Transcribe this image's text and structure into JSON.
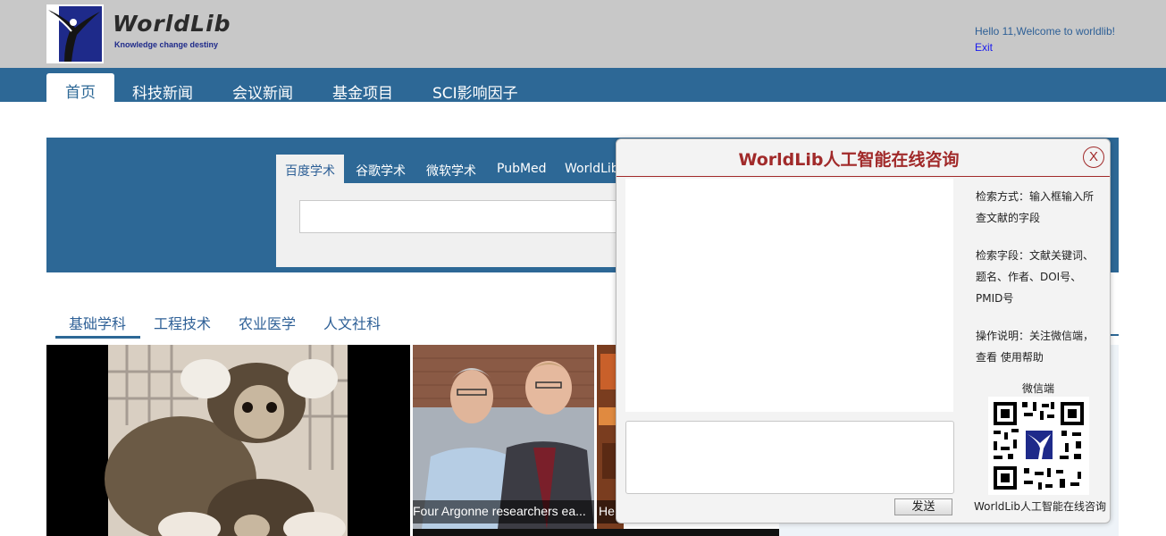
{
  "header": {
    "logo_title": "WorldLib",
    "logo_tagline": "Knowledge change destiny",
    "welcome": "Hello 11,Welcome to worldlib!",
    "exit": "Exit"
  },
  "nav": {
    "items": [
      {
        "label": "首页",
        "active": true
      },
      {
        "label": "科技新闻"
      },
      {
        "label": "会议新闻"
      },
      {
        "label": "基金项目"
      },
      {
        "label": "SCI影响因子"
      }
    ]
  },
  "search": {
    "tabs": [
      {
        "label": "百度学术",
        "active": true
      },
      {
        "label": "谷歌学术"
      },
      {
        "label": "微软学术"
      },
      {
        "label": "PubMed"
      },
      {
        "label": "WorldLib"
      }
    ],
    "input_value": ""
  },
  "subjects": {
    "items": [
      {
        "label": "基础学科",
        "active": true
      },
      {
        "label": "工程技术"
      },
      {
        "label": "农业医学"
      },
      {
        "label": "人文社科"
      }
    ]
  },
  "news": {
    "caption_2": "Four Argonne researchers ea...",
    "caption_3": "He"
  },
  "chat": {
    "title": "WorldLib人工智能在线咨询",
    "close": "X",
    "send": "发送",
    "help_search_method": "检索方式：输入框输入所查文献的字段",
    "help_search_fields": "检索字段：文献关键词、题名、作者、DOI号、PMID号",
    "help_operation": "操作说明：关注微信端，查看 使用帮助",
    "wechat_label": "微信端",
    "qr_caption": "WorldLib人工智能在线咨询"
  },
  "colors": {
    "header_bg": "#c8c8c8",
    "nav_bg": "#2d6896",
    "chat_title": "#a12a2a"
  }
}
